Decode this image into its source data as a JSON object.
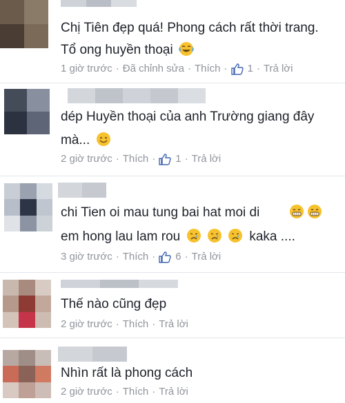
{
  "comments": [
    {
      "text_lines": [
        "Chị Tiên đẹp quá! Phong cách rất thời trang.",
        "Tổ ong huyền thoại"
      ],
      "time": "1 giờ trước",
      "edited": "Đã chỉnh sửa",
      "like_label": "Thích",
      "like_count": "1",
      "reply_label": "Trả lời",
      "emoji": "crying-laughing-emoji"
    },
    {
      "text_lines": [
        "dép Huyền thoại của anh Trường giang đây",
        "mà..."
      ],
      "time": "2 giờ trước",
      "like_label": "Thích",
      "like_count": "1",
      "reply_label": "Trả lời",
      "emoji": "smiling-emoji"
    },
    {
      "text_lines": [
        "chi Tien oi mau tung bai hat moi di",
        "em hong lau lam rou",
        "kaka ...."
      ],
      "time": "3 giờ trước",
      "like_label": "Thích",
      "like_count": "6",
      "reply_label": "Trả lời",
      "emoji": "grinning-emoji"
    },
    {
      "text_lines": [
        "Thế nào cũng đẹp"
      ],
      "time": "2 giờ trước",
      "like_label": "Thích",
      "reply_label": "Trả lời"
    },
    {
      "text_lines": [
        "Nhìn rất là phong cách"
      ],
      "time": "2 giờ trước",
      "like_label": "Thích",
      "reply_label": "Trả lời"
    }
  ],
  "colors": {
    "text": "#1d2129",
    "meta": "#90949c",
    "like_icon": "#4267b2",
    "emoji_face": "#f7c22e"
  }
}
